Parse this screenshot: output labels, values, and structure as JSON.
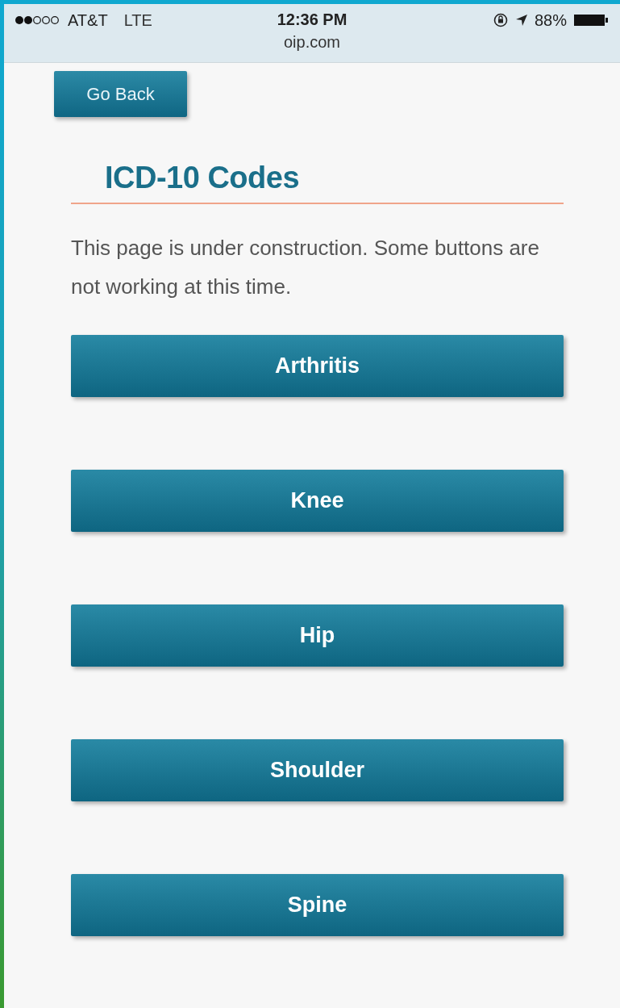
{
  "status_bar": {
    "carrier": "AT&T",
    "network": "LTE",
    "time": "12:36 PM",
    "battery": "88%"
  },
  "address_bar": {
    "url": "oip.com"
  },
  "back_button": {
    "label": "Go Back"
  },
  "heading": "ICD-10 Codes",
  "notice": "This page is under construction. Some buttons are not working at this time.",
  "buttons": [
    {
      "label": "Arthritis"
    },
    {
      "label": "Knee"
    },
    {
      "label": "Hip"
    },
    {
      "label": "Shoulder"
    },
    {
      "label": "Spine"
    }
  ]
}
